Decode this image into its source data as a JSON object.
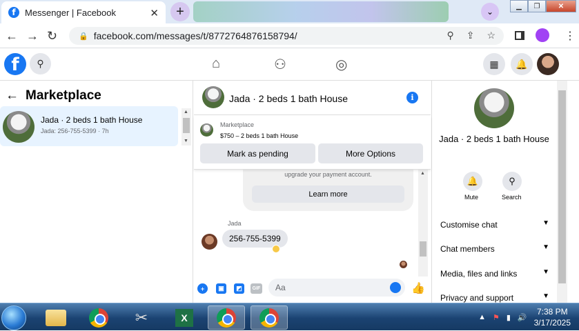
{
  "browser": {
    "tab_title": "Messenger | Facebook",
    "tab_close": "✕",
    "new_tab": "+",
    "url": "facebook.com/messages/t/8772764876158794/"
  },
  "left_panel": {
    "back": "←",
    "title": "Marketplace",
    "conversation": {
      "title": "Jada · 2 beds 1 bath House",
      "preview": "Jada: 256-755-5399 · 7h"
    }
  },
  "chat": {
    "title": "Jada · 2 beds 1 bath House",
    "info": "i",
    "marketplace_label": "Marketplace",
    "listing": "$750 – 2 beds 1 bath House",
    "mark_pending": "Mark as pending",
    "more_options": "More Options",
    "system_text": "upgrade your payment account.",
    "learn_more": "Learn more",
    "sender": "Jada",
    "message": "256-755-5399",
    "composer_placeholder": "Aa",
    "gif": "GIF"
  },
  "right_panel": {
    "title": "Jada · 2 beds 1 bath House",
    "mute": "Mute",
    "search": "Search",
    "items": [
      "Customise chat",
      "Chat members",
      "Media, files and links",
      "Privacy and support"
    ]
  },
  "taskbar": {
    "time": "7:38 PM",
    "date": "3/17/2025"
  },
  "colors": {
    "fb_blue": "#1877f2",
    "selected_bg": "#e7f3ff",
    "taskbar": "#1b4372"
  }
}
